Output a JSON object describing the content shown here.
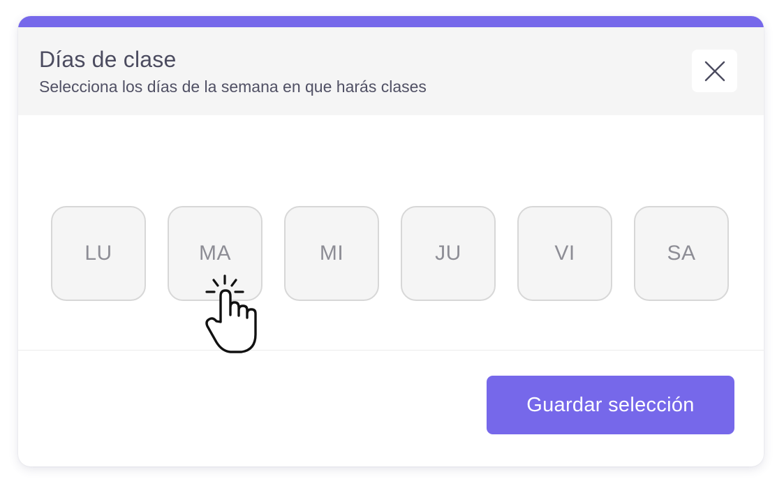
{
  "modal": {
    "title": "Días de clase",
    "subtitle": "Selecciona los días de la semana en que harás clases",
    "close_icon": "close-icon",
    "accent_color": "#7668ea"
  },
  "days": [
    {
      "label": "LU",
      "selected": false
    },
    {
      "label": "MA",
      "selected": false
    },
    {
      "label": "MI",
      "selected": false
    },
    {
      "label": "JU",
      "selected": false
    },
    {
      "label": "VI",
      "selected": false
    },
    {
      "label": "SA",
      "selected": false
    }
  ],
  "footer": {
    "save_label": "Guardar selección"
  },
  "cursor": {
    "icon": "hand-pointer-click-icon"
  }
}
